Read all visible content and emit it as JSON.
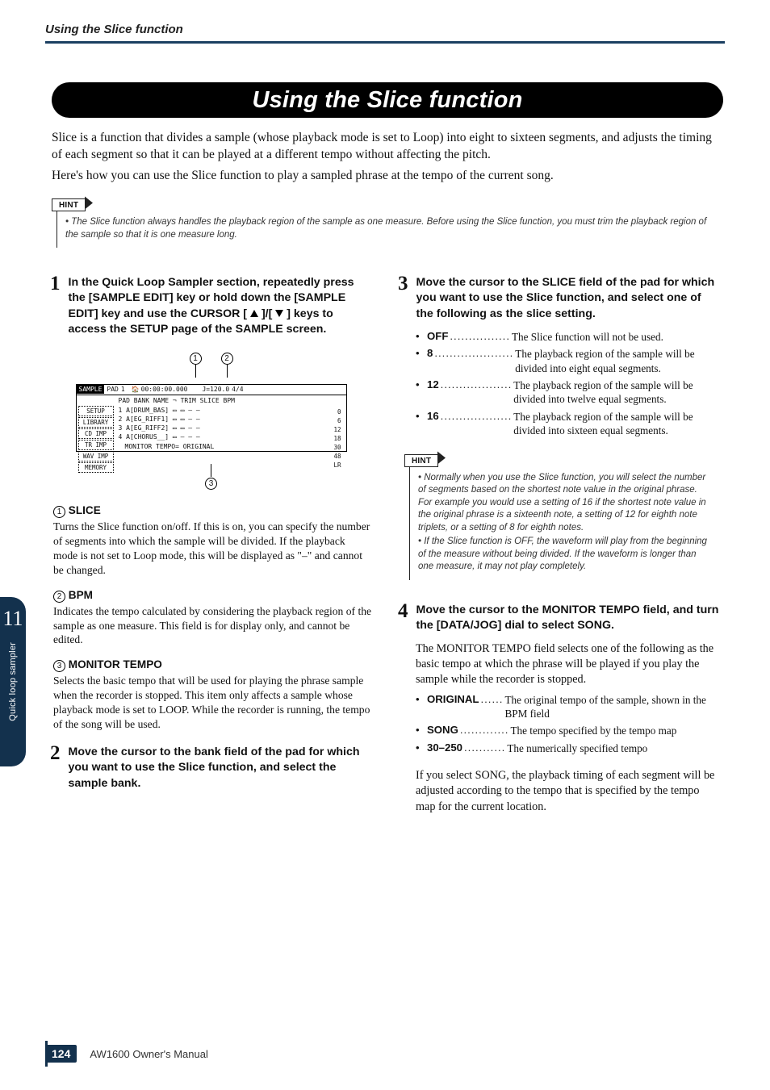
{
  "chapterHeader": "Using the Slice function",
  "titleBanner": "Using the Slice function",
  "intro1": "Slice is a function that divides a sample (whose playback mode is set to Loop) into eight to sixteen segments, and adjusts the timing of each segment so that it can be played at a different tempo without affecting the pitch.",
  "intro2": "Here's how you can use the Slice function to play a sampled phrase at the tempo of the current song.",
  "hintLabel": "HINT",
  "hint1": "The Slice function always handles the playback region of the sample as one measure. Before using the Slice function, you must trim the playback region of the sample so that it is one measure long.",
  "step1": {
    "num": "1",
    "headA": "In the Quick Loop Sampler section, repeatedly press the [SAMPLE EDIT] key or hold down the [SAMPLE EDIT] key and use the CURSOR [",
    "headB": "]/[",
    "headC": "] keys to access the SETUP page of the SAMPLE screen."
  },
  "fig": {
    "c1": "1",
    "c2": "2",
    "c3": "3",
    "hdr_sample": "SAMPLE",
    "hdr_pad": "PAD",
    "hdr_padnum": "1",
    "hdr_counter": "00:00:00.000",
    "hdr_tempo": "J=120.0",
    "hdr_sig": "4/4",
    "row_head": "PAD BANK        NAME ¬   TRIM  SLICE   BPM",
    "row1": "1  A[DRUM_BAS]  ▭    ▭     –     –",
    "row2": "2  A[EG_RIFF1]  ▭    ▭     –     –",
    "row3": "3  A[EG_RIFF2]  ▭    ▭     –     –",
    "row4": "4  A[CHORUS__]  ▭    –     –     –",
    "menu1": "SETUP",
    "menu2": "LIBRARY",
    "menu3": "CD  IMP",
    "menu4": "TR  IMP",
    "menu5": "WAV IMP",
    "menu6": "MEMORY",
    "bottom": "MONITOR TEMPO= ORIGINAL",
    "right": "0\n6\n12\n18\n30\n48\nLR"
  },
  "feat1": {
    "label": " SLICE",
    "body": "Turns the Slice function on/off. If this is on, you can specify the number of segments into which the sample will be divided. If the playback mode is not set to Loop mode, this will be displayed as \"–\" and cannot be changed."
  },
  "feat2": {
    "label": " BPM",
    "body": "Indicates the tempo calculated by considering the playback region of the sample as one measure. This field is for display only, and cannot be edited."
  },
  "feat3": {
    "label": " MONITOR TEMPO",
    "body": "Selects the basic tempo that will be used for playing the phrase sample when the recorder is stopped. This item only affects a sample whose playback mode is set to LOOP. While the recorder is running, the tempo of the song will be used."
  },
  "step2": {
    "num": "2",
    "head": "Move the cursor to the bank field of the pad for which you want to use the Slice function, and select the sample bank."
  },
  "step3": {
    "num": "3",
    "head": "Move the cursor to the SLICE field of the pad for which you want to use the Slice function, and select one of the following as the slice setting."
  },
  "s3list": {
    "off_k": "OFF",
    "off_d": "................",
    "off_b": "The Slice function will not be used.",
    "k8": "8",
    "d8": ".....................",
    "b8": "The playback region of the sample will be divided into eight equal segments.",
    "k12": "12",
    "d12": "...................",
    "b12": "The playback region of the sample will be divided into twelve equal segments.",
    "k16": "16",
    "d16": "...................",
    "b16": "The playback region of the sample will be divided into sixteen equal segments."
  },
  "hint2a": "Normally when you use the Slice function, you will select the number of segments based on the shortest note value in the original phrase. For example you would use a setting of 16 if the shortest note value in the original phrase is a sixteenth note, a setting of 12 for eighth note triplets, or a setting of 8 for eighth notes.",
  "hint2b": "If the Slice function is OFF, the waveform will play from the beginning of the measure without being divided. If the waveform is longer than one measure, it may not play completely.",
  "step4": {
    "num": "4",
    "head": "Move the cursor to the MONITOR TEMPO field, and turn the [DATA/JOG] dial to select SONG."
  },
  "s4intro": "The MONITOR TEMPO field selects one of the following as the basic tempo at which the phrase will be played if you play the sample while the recorder is stopped.",
  "s4list": {
    "orig_k": "ORIGINAL",
    "orig_d": "......",
    "orig_b": "The original tempo of the sample, shown in the BPM field",
    "song_k": "SONG",
    "song_d": ".............",
    "song_b": "The tempo specified by the tempo map",
    "num_k": "30–250",
    "num_d": "...........",
    "num_b": "The numerically specified tempo"
  },
  "s4outro": "If you select SONG, the playback timing of each segment will be adjusted according to the tempo that is specified by the tempo map for the current location.",
  "sidetabNum": "11",
  "sidetabText": "Quick loop sampler",
  "pageNum": "124",
  "footerText": "AW1600  Owner's Manual"
}
